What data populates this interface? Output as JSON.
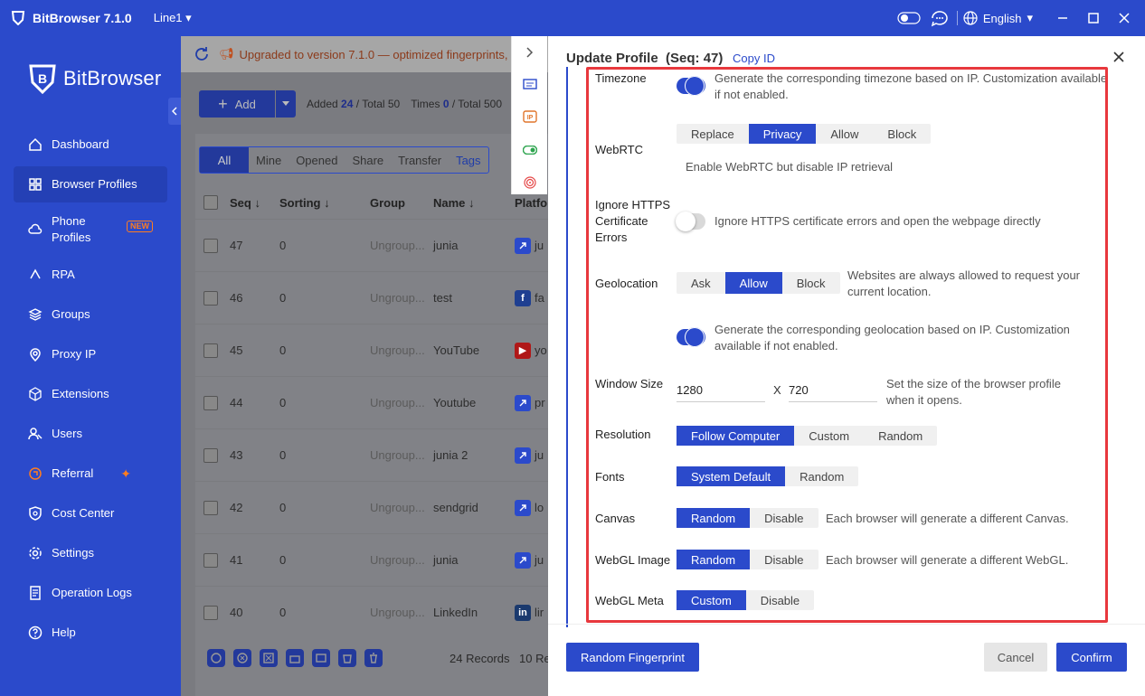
{
  "titlebar": {
    "app_title": "BitBrowser 7.1.0",
    "line": "Line1",
    "language": "English"
  },
  "sidebar": {
    "brand": "BitBrowser",
    "items": [
      {
        "label": "Dashboard",
        "icon": "home-icon"
      },
      {
        "label": "Browser Profiles",
        "icon": "grid-icon",
        "active": true
      },
      {
        "label": "Phone Profiles",
        "icon": "cloud-icon",
        "badge": "NEW"
      },
      {
        "label": "RPA",
        "icon": "rpa-icon"
      },
      {
        "label": "Groups",
        "icon": "layers-icon"
      },
      {
        "label": "Proxy IP",
        "icon": "location-icon"
      },
      {
        "label": "Extensions",
        "icon": "cube-icon"
      },
      {
        "label": "Users",
        "icon": "users-icon"
      },
      {
        "label": "Referral",
        "icon": "referral-icon"
      },
      {
        "label": "Cost Center",
        "icon": "shield-icon"
      },
      {
        "label": "Settings",
        "icon": "gear-icon"
      },
      {
        "label": "Operation Logs",
        "icon": "log-icon"
      },
      {
        "label": "Help",
        "icon": "help-icon"
      }
    ]
  },
  "notice": "Upgraded to version 7.1.0 — optimized fingerprints,",
  "toolbar": {
    "add_label": "Add",
    "added_label": "Added",
    "added_value": "24",
    "total_label": "/ Total 50",
    "times_label": "Times",
    "times_value": "0",
    "times_total": "/ Total 500"
  },
  "list_tabs": [
    "All",
    "Mine",
    "Opened",
    "Share",
    "Transfer",
    "Tags"
  ],
  "columns": [
    "Seq ↓",
    "Sorting ↓",
    "Group",
    "Name ↓",
    "Platfo"
  ],
  "rows": [
    {
      "seq": "47",
      "sorting": "0",
      "group": "Ungroup...",
      "name": "junia",
      "platform": "ju",
      "icon": "link",
      "color": "#2b4acb"
    },
    {
      "seq": "46",
      "sorting": "0",
      "group": "Ungroup...",
      "name": "test",
      "platform": "fa",
      "icon": "f",
      "color": "#1f3f91"
    },
    {
      "seq": "45",
      "sorting": "0",
      "group": "Ungroup...",
      "name": "YouTube",
      "platform": "yo",
      "icon": "▶",
      "color": "#b01818"
    },
    {
      "seq": "44",
      "sorting": "0",
      "group": "Ungroup...",
      "name": "Youtube",
      "platform": "pr",
      "icon": "link",
      "color": "#2b4acb"
    },
    {
      "seq": "43",
      "sorting": "0",
      "group": "Ungroup...",
      "name": "junia 2",
      "platform": "ju",
      "icon": "link",
      "color": "#2b4acb"
    },
    {
      "seq": "42",
      "sorting": "0",
      "group": "Ungroup...",
      "name": "sendgrid",
      "platform": "lo",
      "icon": "link",
      "color": "#2b4acb"
    },
    {
      "seq": "41",
      "sorting": "0",
      "group": "Ungroup...",
      "name": "junia",
      "platform": "ju",
      "icon": "link",
      "color": "#2b4acb"
    },
    {
      "seq": "40",
      "sorting": "0",
      "group": "Ungroup...",
      "name": "LinkedIn",
      "platform": "lir",
      "icon": "in",
      "color": "#1b3a6e"
    }
  ],
  "footer_list": {
    "records": "24 Records",
    "per_page": "10 Re"
  },
  "panel": {
    "title": "Update Profile",
    "seq": "(Seq: 47)",
    "copy_id": "Copy ID",
    "timezone": {
      "label": "Timezone",
      "desc": "Generate the corresponding timezone based on IP. Customization available if not enabled."
    },
    "webrtc": {
      "label": "WebRTC",
      "options": [
        "Replace",
        "Privacy",
        "Allow",
        "Block"
      ],
      "selected": "Privacy",
      "desc": "Enable WebRTC but disable IP retrieval"
    },
    "https": {
      "label": "Ignore HTTPS Certificate Errors",
      "desc": "Ignore HTTPS certificate errors and open the webpage directly"
    },
    "geolocation": {
      "label": "Geolocation",
      "options": [
        "Ask",
        "Allow",
        "Block"
      ],
      "selected": "Allow",
      "desc": "Websites are always allowed to request your current location.",
      "toggle_desc": "Generate the corresponding geolocation based on IP. Customization available if not enabled."
    },
    "window_size": {
      "label": "Window Size",
      "width": "1280",
      "x": "X",
      "height": "720",
      "desc": "Set the size of the browser profile when it opens."
    },
    "resolution": {
      "label": "Resolution",
      "options": [
        "Follow Computer",
        "Custom",
        "Random"
      ],
      "selected": "Follow Computer"
    },
    "fonts": {
      "label": "Fonts",
      "options": [
        "System Default",
        "Random"
      ],
      "selected": "System Default"
    },
    "canvas": {
      "label": "Canvas",
      "options": [
        "Random",
        "Disable"
      ],
      "selected": "Random",
      "desc": "Each browser will generate a different Canvas."
    },
    "webgl_image": {
      "label": "WebGL Image",
      "options": [
        "Random",
        "Disable"
      ],
      "selected": "Random",
      "desc": "Each browser will generate a different WebGL."
    },
    "webgl_meta": {
      "label": "WebGL Meta",
      "options": [
        "Custom",
        "Disable"
      ],
      "selected": "Custom"
    },
    "buttons": {
      "random": "Random Fingerprint",
      "cancel": "Cancel",
      "confirm": "Confirm"
    }
  }
}
